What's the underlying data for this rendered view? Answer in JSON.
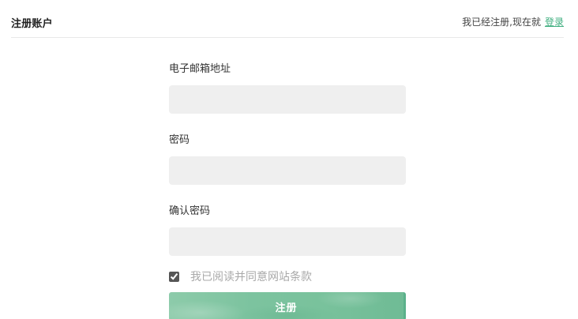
{
  "header": {
    "title": "注册账户",
    "already_registered_text": "我已经注册,现在就",
    "login_link": "登录"
  },
  "form": {
    "email": {
      "label": "电子邮箱地址",
      "value": "",
      "placeholder": ""
    },
    "password": {
      "label": "密码",
      "value": "",
      "placeholder": ""
    },
    "confirm_password": {
      "label": "确认密码",
      "value": "",
      "placeholder": ""
    },
    "agree": {
      "checked": true,
      "label": "我已阅读并同意网站条款"
    },
    "submit_label": "注册"
  },
  "colors": {
    "accent": "#3fae7f",
    "input_bg": "#efefef",
    "button_green": "#7cc39f"
  }
}
